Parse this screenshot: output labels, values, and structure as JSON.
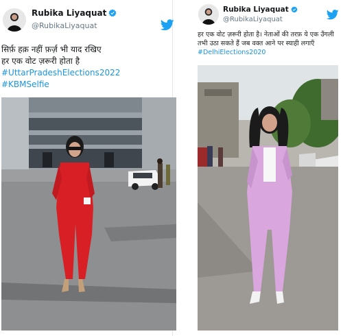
{
  "tweets": [
    {
      "author": {
        "name": "Rubika Liyaquat",
        "handle": "@RubikaLiyaquat"
      },
      "lines": [
        "सिर्फ़ हक़ नहीं फ़र्ज़ भी याद रखिए",
        "हर एक वोट ज़रूरी होता है"
      ],
      "hashtags": [
        "#UttarPradeshElections2022",
        "#KBMSelfie"
      ]
    },
    {
      "author": {
        "name": "Rubika Liyaquat",
        "handle": "@RubikaLiyaquat"
      },
      "lines": [
        "हर एक वोट ज़रूरी होता है। नेताओं की तरफ़ ये एक उँगली",
        "तभी उठा सकते हैं जब वक्त आने पर स्याही लगाएँ"
      ],
      "hashtags": [
        "#DelhiElections2020"
      ]
    }
  ],
  "colors": {
    "link": "#1b95e0",
    "verified": "#1da1f2",
    "twitter": "#1da1f2",
    "left_suit": "#d81f26",
    "right_suit": "#d9a6dd"
  },
  "icons": {
    "verified": "verified-badge-icon",
    "bird": "twitter-bird-icon"
  }
}
